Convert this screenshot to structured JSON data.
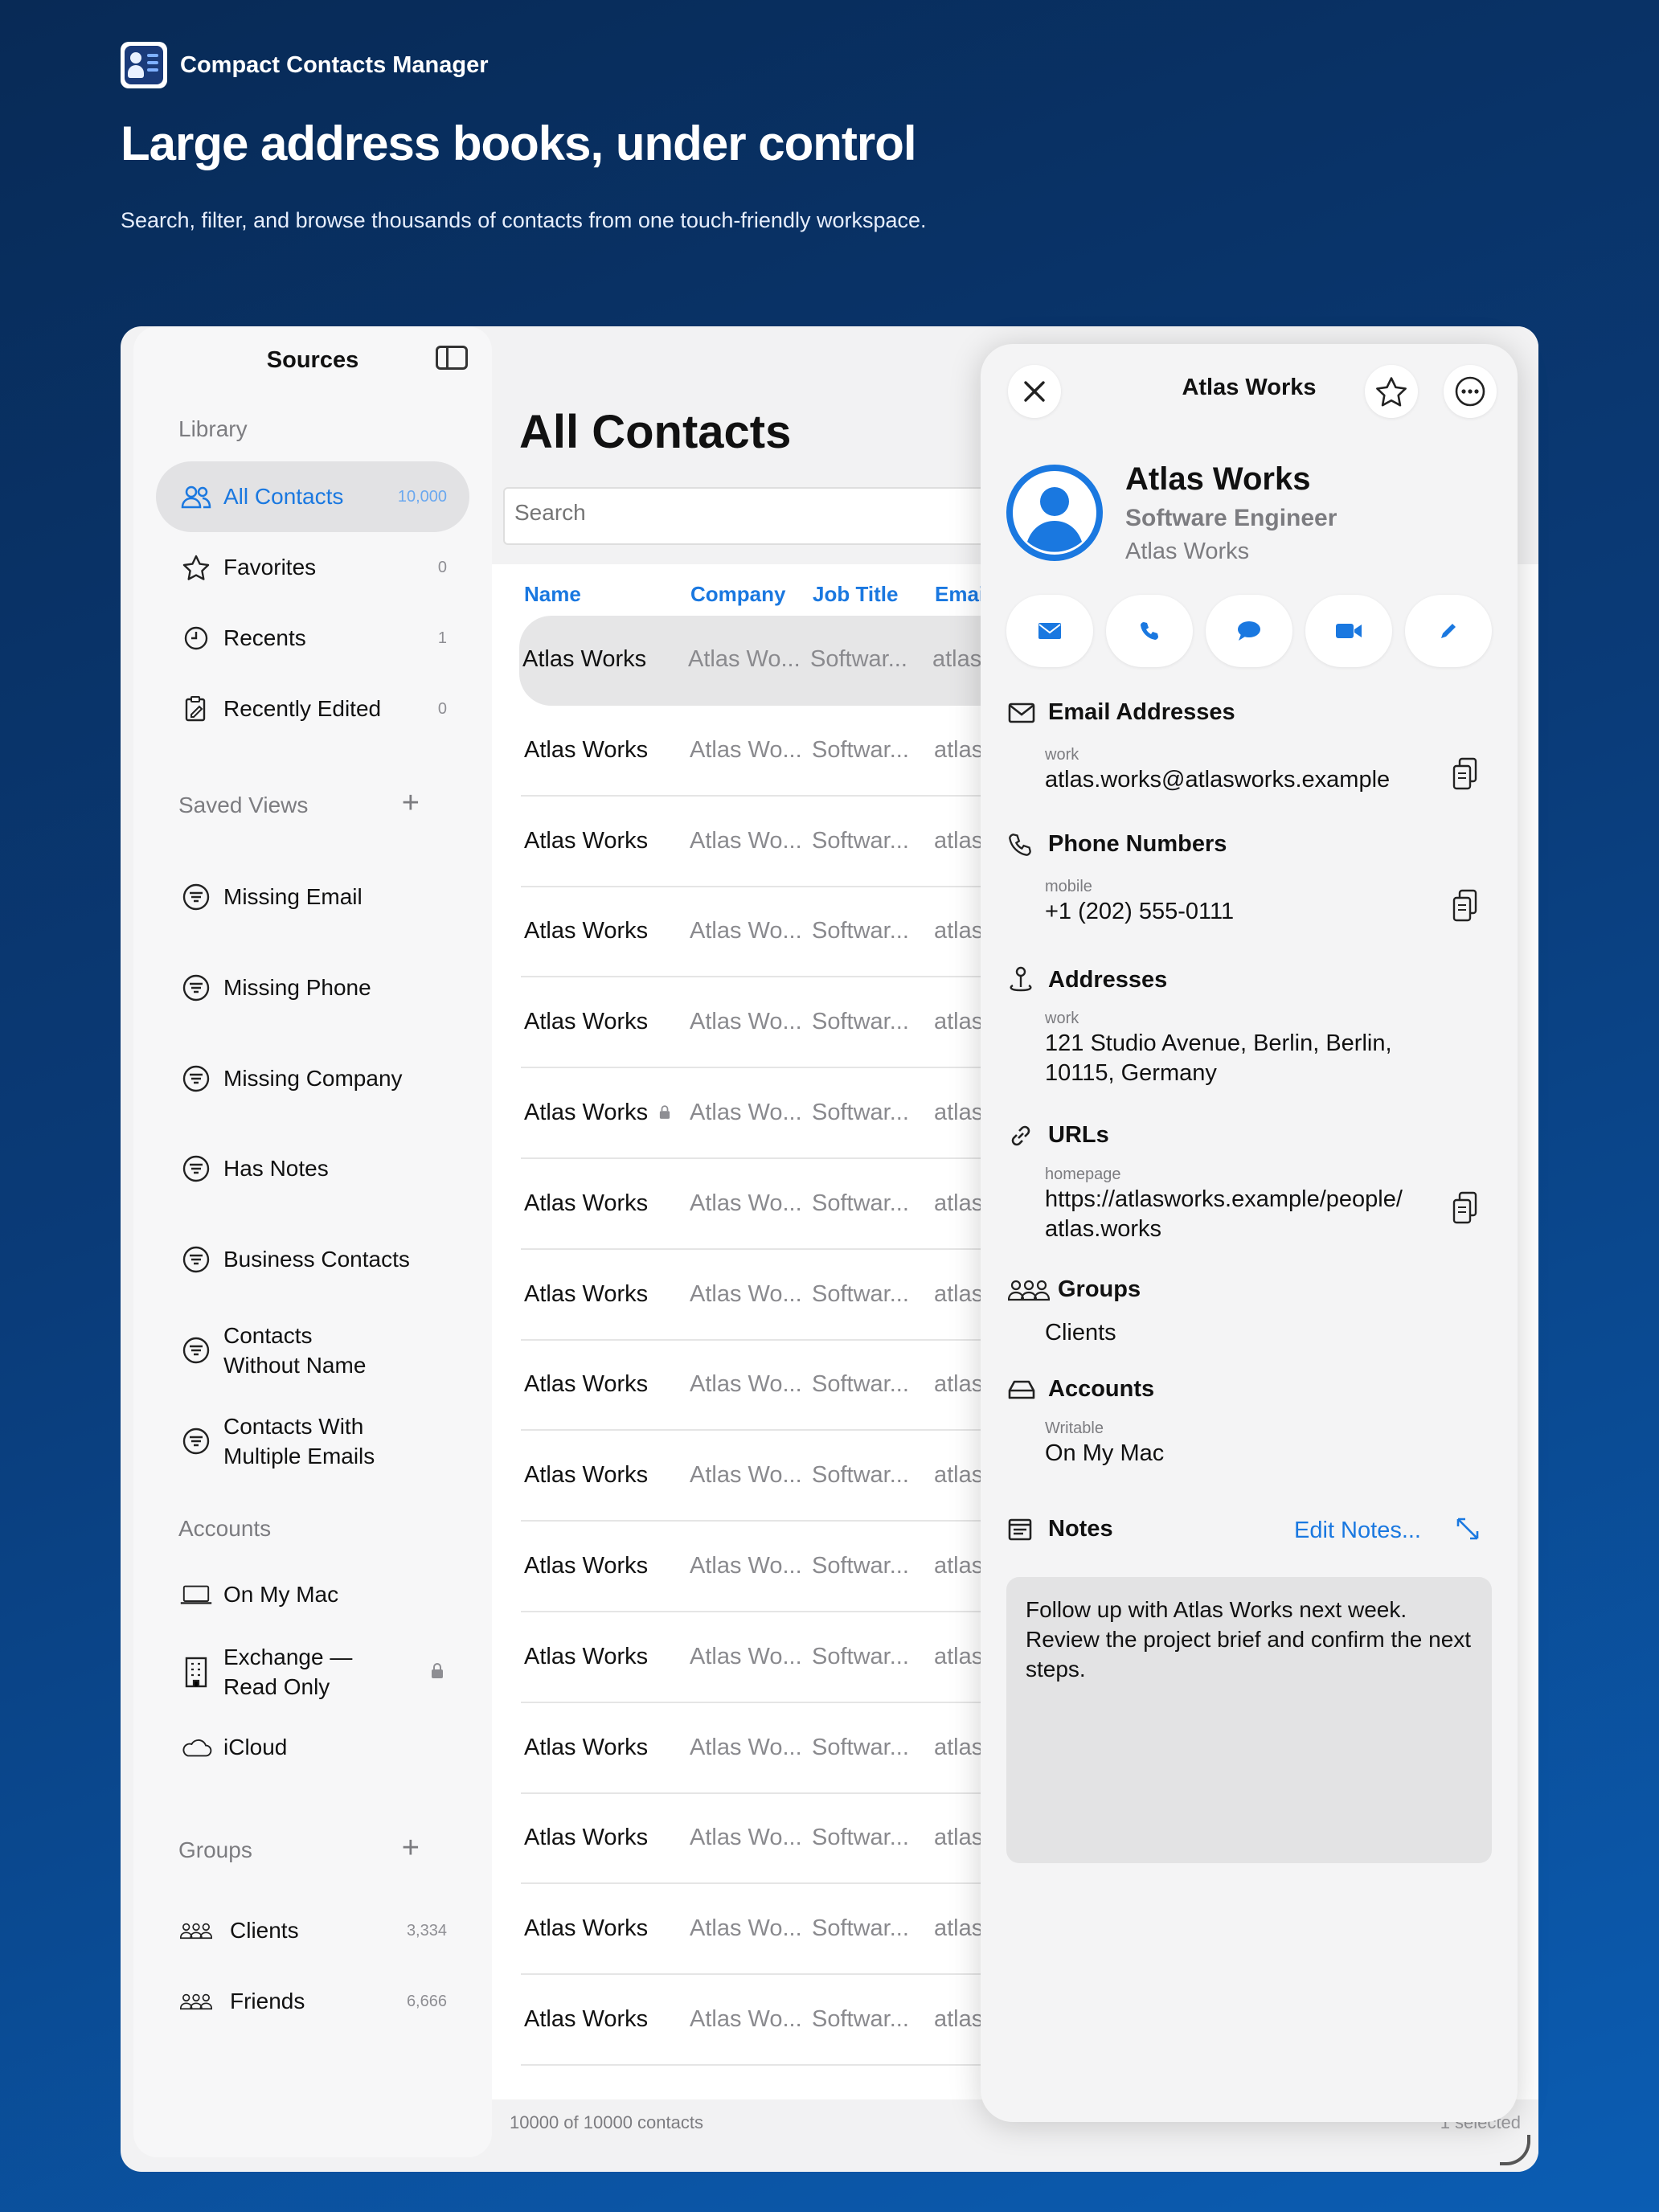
{
  "hero": {
    "app_name": "Compact Contacts Manager",
    "headline": "Large address books, under control",
    "tagline": "Search, filter, and browse thousands of contacts from one touch-friendly workspace."
  },
  "sidebar": {
    "title": "Sources",
    "library_label": "Library",
    "library": [
      {
        "label": "All Contacts",
        "count": "10,000",
        "icon": "people-icon"
      },
      {
        "label": "Favorites",
        "count": "0",
        "icon": "star-icon"
      },
      {
        "label": "Recents",
        "count": "1",
        "icon": "clock-icon"
      },
      {
        "label": "Recently Edited",
        "count": "0",
        "icon": "clipboard-edit-icon"
      }
    ],
    "saved_views_label": "Saved Views",
    "saved_views": [
      {
        "label": "Missing Email"
      },
      {
        "label": "Missing Phone"
      },
      {
        "label": "Missing Company"
      },
      {
        "label": "Has Notes"
      },
      {
        "label": "Business Contacts"
      },
      {
        "label": "Contacts Without Name"
      },
      {
        "label": "Contacts With Multiple Emails"
      }
    ],
    "accounts_label": "Accounts",
    "accounts": [
      {
        "label": "On My Mac",
        "icon": "laptop-icon"
      },
      {
        "label": "Exchange — Read Only",
        "icon": "building-icon",
        "locked": true
      },
      {
        "label": "iCloud",
        "icon": "cloud-icon"
      }
    ],
    "groups_label": "Groups",
    "groups": [
      {
        "label": "Clients",
        "count": "3,334"
      },
      {
        "label": "Friends",
        "count": "6,666"
      }
    ]
  },
  "main": {
    "title": "All Contacts",
    "search_placeholder": "Search",
    "columns": [
      "Name",
      "Company",
      "Job Title",
      "Emai"
    ],
    "rows": [
      {
        "name": "Atlas Works",
        "company": "Atlas Wo...",
        "job": "Softwar...",
        "email": "atlas"
      },
      {
        "name": "Atlas Works",
        "company": "Atlas Wo...",
        "job": "Softwar...",
        "email": "atlas"
      },
      {
        "name": "Atlas Works",
        "company": "Atlas Wo...",
        "job": "Softwar...",
        "email": "atlas"
      },
      {
        "name": "Atlas Works",
        "company": "Atlas Wo...",
        "job": "Softwar...",
        "email": "atlas"
      },
      {
        "name": "Atlas Works",
        "company": "Atlas Wo...",
        "job": "Softwar...",
        "email": "atlas"
      },
      {
        "name": "Atlas Works",
        "company": "Atlas Wo...",
        "job": "Softwar...",
        "email": "atlas"
      },
      {
        "name": "Atlas Works",
        "company": "Atlas Wo...",
        "job": "Softwar...",
        "email": "atlas"
      },
      {
        "name": "Atlas Works",
        "company": "Atlas Wo...",
        "job": "Softwar...",
        "email": "atlas"
      },
      {
        "name": "Atlas Works",
        "company": "Atlas Wo...",
        "job": "Softwar...",
        "email": "atlas"
      },
      {
        "name": "Atlas Works",
        "company": "Atlas Wo...",
        "job": "Softwar...",
        "email": "atlas"
      },
      {
        "name": "Atlas Works",
        "company": "Atlas Wo...",
        "job": "Softwar...",
        "email": "atlas"
      },
      {
        "name": "Atlas Works",
        "company": "Atlas Wo...",
        "job": "Softwar...",
        "email": "atlas"
      },
      {
        "name": "Atlas Works",
        "company": "Atlas Wo...",
        "job": "Softwar...",
        "email": "atlas"
      },
      {
        "name": "Atlas Works",
        "company": "Atlas Wo...",
        "job": "Softwar...",
        "email": "atlas"
      },
      {
        "name": "Atlas Works",
        "company": "Atlas Wo...",
        "job": "Softwar...",
        "email": "atlas"
      },
      {
        "name": "Atlas Works",
        "company": "Atlas Wo...",
        "job": "Softwar...",
        "email": "atlas"
      }
    ],
    "footer_count": "10000 of 10000 contacts",
    "footer_selected": "1 selected"
  },
  "detail": {
    "title": "Atlas Works",
    "name": "Atlas Works",
    "job_title": "Software Engineer",
    "company": "Atlas Works",
    "quick_actions": [
      "envelope-icon",
      "phone-icon",
      "message-icon",
      "video-icon",
      "pencil-icon"
    ],
    "email_section": "Email Addresses",
    "email_label": "work",
    "email_value": "atlas.works@atlasworks.example",
    "phone_section": "Phone Numbers",
    "phone_label": "mobile",
    "phone_value": "+1 (202) 555-0111",
    "address_section": "Addresses",
    "address_label": "work",
    "address_value": "121 Studio Avenue, Berlin, Berlin, 10115, Germany",
    "urls_section": "URLs",
    "url_label": "homepage",
    "url_value": "https://atlasworks.example/people/ atlas.works",
    "groups_section": "Groups",
    "groups_value": "Clients",
    "accounts_section": "Accounts",
    "accounts_label": "Writable",
    "accounts_value": "On My Mac",
    "notes_section": "Notes",
    "edit_notes": "Edit Notes...",
    "notes_text": "Follow up with Atlas Works next week. Review the project brief and confirm the next steps."
  },
  "colors": {
    "accent": "#1a78e0",
    "background_top": "#082a56",
    "background_bottom": "#0b5db3"
  }
}
